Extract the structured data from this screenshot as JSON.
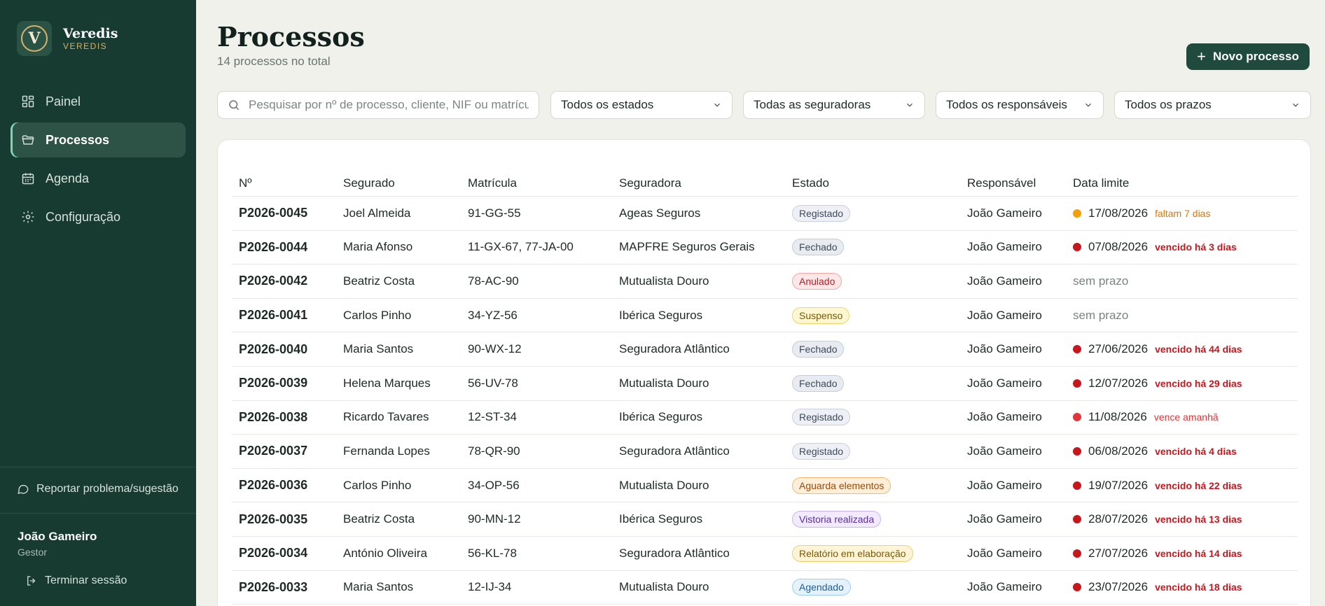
{
  "brand": {
    "logo_letter": "V",
    "name": "Veredis",
    "sub": "VEREDIS"
  },
  "nav": [
    {
      "label": "Painel",
      "icon": "dashboard-icon",
      "active": false
    },
    {
      "label": "Processos",
      "icon": "folder-icon",
      "active": true
    },
    {
      "label": "Agenda",
      "icon": "calendar-icon",
      "active": false
    },
    {
      "label": "Configuração",
      "icon": "gear-icon",
      "active": false
    }
  ],
  "sidebar_footer": {
    "report_label": "Reportar problema/sugestão",
    "user_name": "João Gameiro",
    "user_role": "Gestor",
    "logout_label": "Terminar sessão"
  },
  "header": {
    "title": "Processos",
    "subtitle": "14 processos no total",
    "new_button": "Novo processo"
  },
  "filters": {
    "search_placeholder": "Pesquisar por nº de processo, cliente, NIF ou matrícula",
    "estado": "Todos os estados",
    "seguradora": "Todas as seguradoras",
    "responsavel": "Todos os responsáveis",
    "prazo": "Todos os prazos"
  },
  "table": {
    "headers": [
      "Nº",
      "Segurado",
      "Matrícula",
      "Seguradora",
      "Estado",
      "Responsável",
      "Data limite"
    ],
    "rows": [
      {
        "num": "P2026-0045",
        "segurado": "Joel Almeida",
        "matricula": "91-GG-55",
        "seguradora": "Ageas Seguros",
        "estado": "Registado",
        "estado_type": "registado",
        "responsavel": "João Gameiro",
        "date": "17/08/2026",
        "note": "faltam 7 dias",
        "deadline": "soon"
      },
      {
        "num": "P2026-0044",
        "segurado": "Maria Afonso",
        "matricula": "11-GX-67, 77-JA-00",
        "seguradora": "MAPFRE Seguros Gerais",
        "estado": "Fechado",
        "estado_type": "fechado",
        "responsavel": "João Gameiro",
        "date": "07/08/2026",
        "note": "vencido há 3 dias",
        "deadline": "overdue"
      },
      {
        "num": "P2026-0042",
        "segurado": "Beatriz Costa",
        "matricula": "78-AC-90",
        "seguradora": "Mutualista Douro",
        "estado": "Anulado",
        "estado_type": "anulado",
        "responsavel": "João Gameiro",
        "date": "",
        "note": "sem prazo",
        "deadline": "none"
      },
      {
        "num": "P2026-0041",
        "segurado": "Carlos Pinho",
        "matricula": "34-YZ-56",
        "seguradora": "Ibérica Seguros",
        "estado": "Suspenso",
        "estado_type": "suspenso",
        "responsavel": "João Gameiro",
        "date": "",
        "note": "sem prazo",
        "deadline": "none"
      },
      {
        "num": "P2026-0040",
        "segurado": "Maria Santos",
        "matricula": "90-WX-12",
        "seguradora": "Seguradora Atlântico",
        "estado": "Fechado",
        "estado_type": "fechado",
        "responsavel": "João Gameiro",
        "date": "27/06/2026",
        "note": "vencido há 44 dias",
        "deadline": "overdue"
      },
      {
        "num": "P2026-0039",
        "segurado": "Helena Marques",
        "matricula": "56-UV-78",
        "seguradora": "Mutualista Douro",
        "estado": "Fechado",
        "estado_type": "fechado",
        "responsavel": "João Gameiro",
        "date": "12/07/2026",
        "note": "vencido há 29 dias",
        "deadline": "overdue"
      },
      {
        "num": "P2026-0038",
        "segurado": "Ricardo Tavares",
        "matricula": "12-ST-34",
        "seguradora": "Ibérica Seguros",
        "estado": "Registado",
        "estado_type": "registado",
        "responsavel": "João Gameiro",
        "date": "11/08/2026",
        "note": "vence amanhã",
        "deadline": "tomorrow"
      },
      {
        "num": "P2026-0037",
        "segurado": "Fernanda Lopes",
        "matricula": "78-QR-90",
        "seguradora": "Seguradora Atlântico",
        "estado": "Registado",
        "estado_type": "registado",
        "responsavel": "João Gameiro",
        "date": "06/08/2026",
        "note": "vencido há 4 dias",
        "deadline": "overdue"
      },
      {
        "num": "P2026-0036",
        "segurado": "Carlos Pinho",
        "matricula": "34-OP-56",
        "seguradora": "Mutualista Douro",
        "estado": "Aguarda elementos",
        "estado_type": "aguarda",
        "responsavel": "João Gameiro",
        "date": "19/07/2026",
        "note": "vencido há 22 dias",
        "deadline": "overdue"
      },
      {
        "num": "P2026-0035",
        "segurado": "Beatriz Costa",
        "matricula": "90-MN-12",
        "seguradora": "Ibérica Seguros",
        "estado": "Vistoria realizada",
        "estado_type": "vistoria",
        "responsavel": "João Gameiro",
        "date": "28/07/2026",
        "note": "vencido há 13 dias",
        "deadline": "overdue"
      },
      {
        "num": "P2026-0034",
        "segurado": "António Oliveira",
        "matricula": "56-KL-78",
        "seguradora": "Seguradora Atlântico",
        "estado": "Relatório em elaboração",
        "estado_type": "relatorio",
        "responsavel": "João Gameiro",
        "date": "27/07/2026",
        "note": "vencido há 14 dias",
        "deadline": "overdue"
      },
      {
        "num": "P2026-0033",
        "segurado": "Maria Santos",
        "matricula": "12-IJ-34",
        "seguradora": "Mutualista Douro",
        "estado": "Agendado",
        "estado_type": "agendado",
        "responsavel": "João Gameiro",
        "date": "23/07/2026",
        "note": "vencido há 18 dias",
        "deadline": "overdue"
      }
    ]
  },
  "colors": {
    "sidebar_bg": "#173a31",
    "accent_gold": "#d6b36a",
    "primary_button": "#1f4a3d",
    "overdue_red": "#c8161d",
    "soon_orange": "#f59e0b",
    "tomorrow_red": "#e0353b",
    "badges": {
      "registado": {
        "bg": "#eef0f6",
        "border": "#c9cfdc",
        "text": "#3d4a5c"
      },
      "fechado": {
        "bg": "#e8ebf0",
        "border": "#c5ccd6",
        "text": "#3d4a5c"
      },
      "anulado": {
        "bg": "#fde7e7",
        "border": "#f2a6a6",
        "text": "#b4232a"
      },
      "suspenso": {
        "bg": "#fff7d1",
        "border": "#f0d46a",
        "text": "#7a5a00"
      },
      "aguarda": {
        "bg": "#ffefd9",
        "border": "#f3b875",
        "text": "#9a4a0a"
      },
      "vistoria": {
        "bg": "#f2eaff",
        "border": "#cbb3f2",
        "text": "#5b2ea6"
      },
      "relatorio": {
        "bg": "#fff5d6",
        "border": "#efcf6b",
        "text": "#7a5a00"
      },
      "agendado": {
        "bg": "#e3f2fd",
        "border": "#9fcdf2",
        "text": "#1d5f99"
      }
    }
  }
}
